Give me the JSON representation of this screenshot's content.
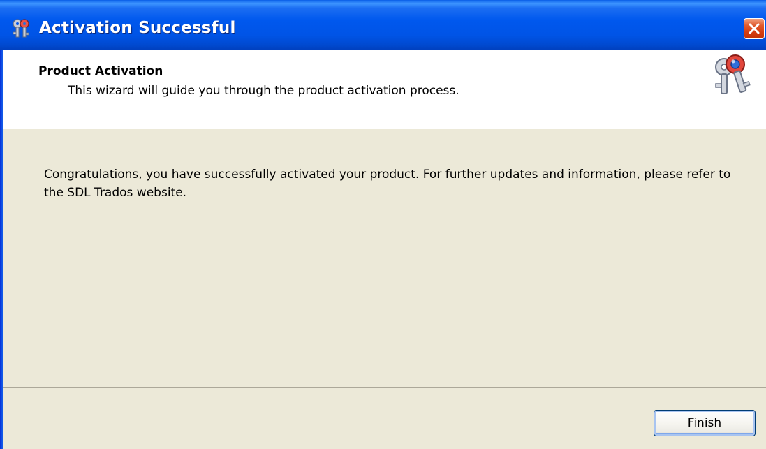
{
  "window": {
    "title": "Activation Successful",
    "icons": {
      "app": "keys-app-icon",
      "close": "close-icon",
      "header": "keys-icon"
    },
    "colors": {
      "titlebar": "#0058ee",
      "close_button": "#d43c10",
      "body_background": "#ece9d8",
      "header_background": "#ffffff"
    }
  },
  "header": {
    "title": "Product Activation",
    "subtitle": "This wizard will guide you through the product activation process."
  },
  "body": {
    "message": "Congratulations, you have successfully activated your product. For further updates and information, please refer to the SDL Trados website."
  },
  "footer": {
    "finish_label": "Finish"
  }
}
